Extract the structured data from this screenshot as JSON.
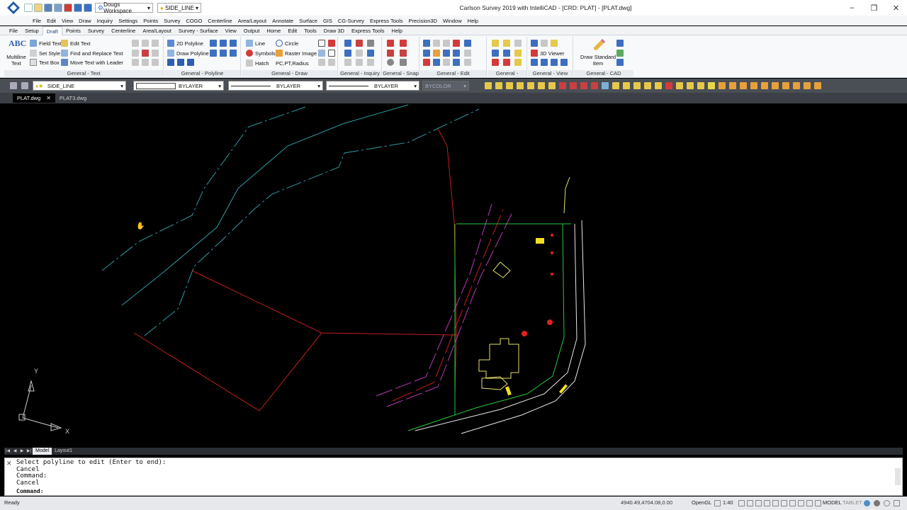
{
  "window": {
    "title": "Carlson Survey 2019 with IntelliCAD - [CRD: PLAT] - [PLAT.dwg]",
    "workspace": "Dougs Workspace",
    "current_layer": "SIDE_LINE",
    "controls": [
      "minimize",
      "restore",
      "close"
    ]
  },
  "menu": [
    "File",
    "Edit",
    "View",
    "Draw",
    "Inquiry",
    "Settings",
    "Points",
    "Survey",
    "COGO",
    "Centerline",
    "Area/Layout",
    "Annotate",
    "Surface",
    "GIS",
    "CG-Survey",
    "Express Tools",
    "Precision3D",
    "Window",
    "Help"
  ],
  "ribbon_tabs": [
    {
      "label": "File",
      "active": false
    },
    {
      "label": "Setup",
      "active": false
    },
    {
      "label": "Draft",
      "active": true
    },
    {
      "label": "Points",
      "active": false
    },
    {
      "label": "Survey",
      "active": false
    },
    {
      "label": "Centerline",
      "active": false
    },
    {
      "label": "Area/Layout",
      "active": false
    },
    {
      "label": "Survey - Surface",
      "active": false
    },
    {
      "label": "View",
      "active": false
    },
    {
      "label": "Output",
      "active": false
    },
    {
      "label": "Home",
      "active": false
    },
    {
      "label": "Edit",
      "active": false
    },
    {
      "label": "Tools",
      "active": false
    },
    {
      "label": "Draw 3D",
      "active": false
    },
    {
      "label": "Express Tools",
      "active": false
    },
    {
      "label": "Help",
      "active": false
    }
  ],
  "ribbon": {
    "general_text": {
      "title": "General - Text",
      "big": "Multiline Text",
      "abc": "ABC",
      "commands": [
        "Field Text",
        "Set Style",
        "Text Box",
        "Edit Text",
        "Find and Replace Text",
        "Move Text with Leader"
      ]
    },
    "general_polyline": {
      "title": "General - Polyline",
      "commands": [
        "2D Polyline",
        "Draw Polyline"
      ]
    },
    "general_draw": {
      "title": "General - Draw",
      "commands": [
        "Line",
        "Circle",
        "Symbols",
        "Raster Image",
        "Hatch",
        "PC,PT,Radius"
      ]
    },
    "general_inquiry": {
      "title": "General - Inquiry"
    },
    "general_snap": {
      "title": "General - Snap"
    },
    "general_edit": {
      "title": "General - Edit"
    },
    "general_layers": {
      "title": "General - Layers"
    },
    "general_view": {
      "title": "General - View",
      "commands": [
        "3D Viewer"
      ]
    },
    "general_cad_standards": {
      "title": "General - CAD Standards",
      "big": "Draw Standard Item"
    }
  },
  "properties_bar": {
    "layer": "SIDE_LINE",
    "color": "BYLAYER",
    "linetype": "BYLAYER",
    "lineweight": "BYLAYER",
    "plotstyle": "BYCOLOR"
  },
  "doc_tabs": [
    {
      "label": "PLAT.dwg",
      "active": true
    },
    {
      "label": "PLAT3.dwg",
      "active": false
    }
  ],
  "ucs": {
    "x_label": "X",
    "y_label": "Y"
  },
  "layout_tabs": [
    {
      "label": "Model",
      "active": true
    },
    {
      "label": "Layout1",
      "active": false
    }
  ],
  "command_line": {
    "history": [
      "Select polyline to edit (Enter to end):",
      "Cancel",
      "Command:",
      "Cancel"
    ],
    "prompt": "Command:"
  },
  "status_bar": {
    "state": "Ready",
    "coordinates": "4940.49,4704.08,0.00",
    "renderer": "OpenGL",
    "scale": "1:40",
    "mode": "MODEL",
    "tablet": "TABLET"
  },
  "colors": {
    "canvas": "#000000",
    "boundary_red": "#c41e1e",
    "contour_cyan": "#2f9aa0",
    "lot_green": "#27c93b",
    "road_white": "#e8e8e8",
    "easement_magenta": "#b53ab8",
    "building_yellow": "#e6e06a"
  }
}
